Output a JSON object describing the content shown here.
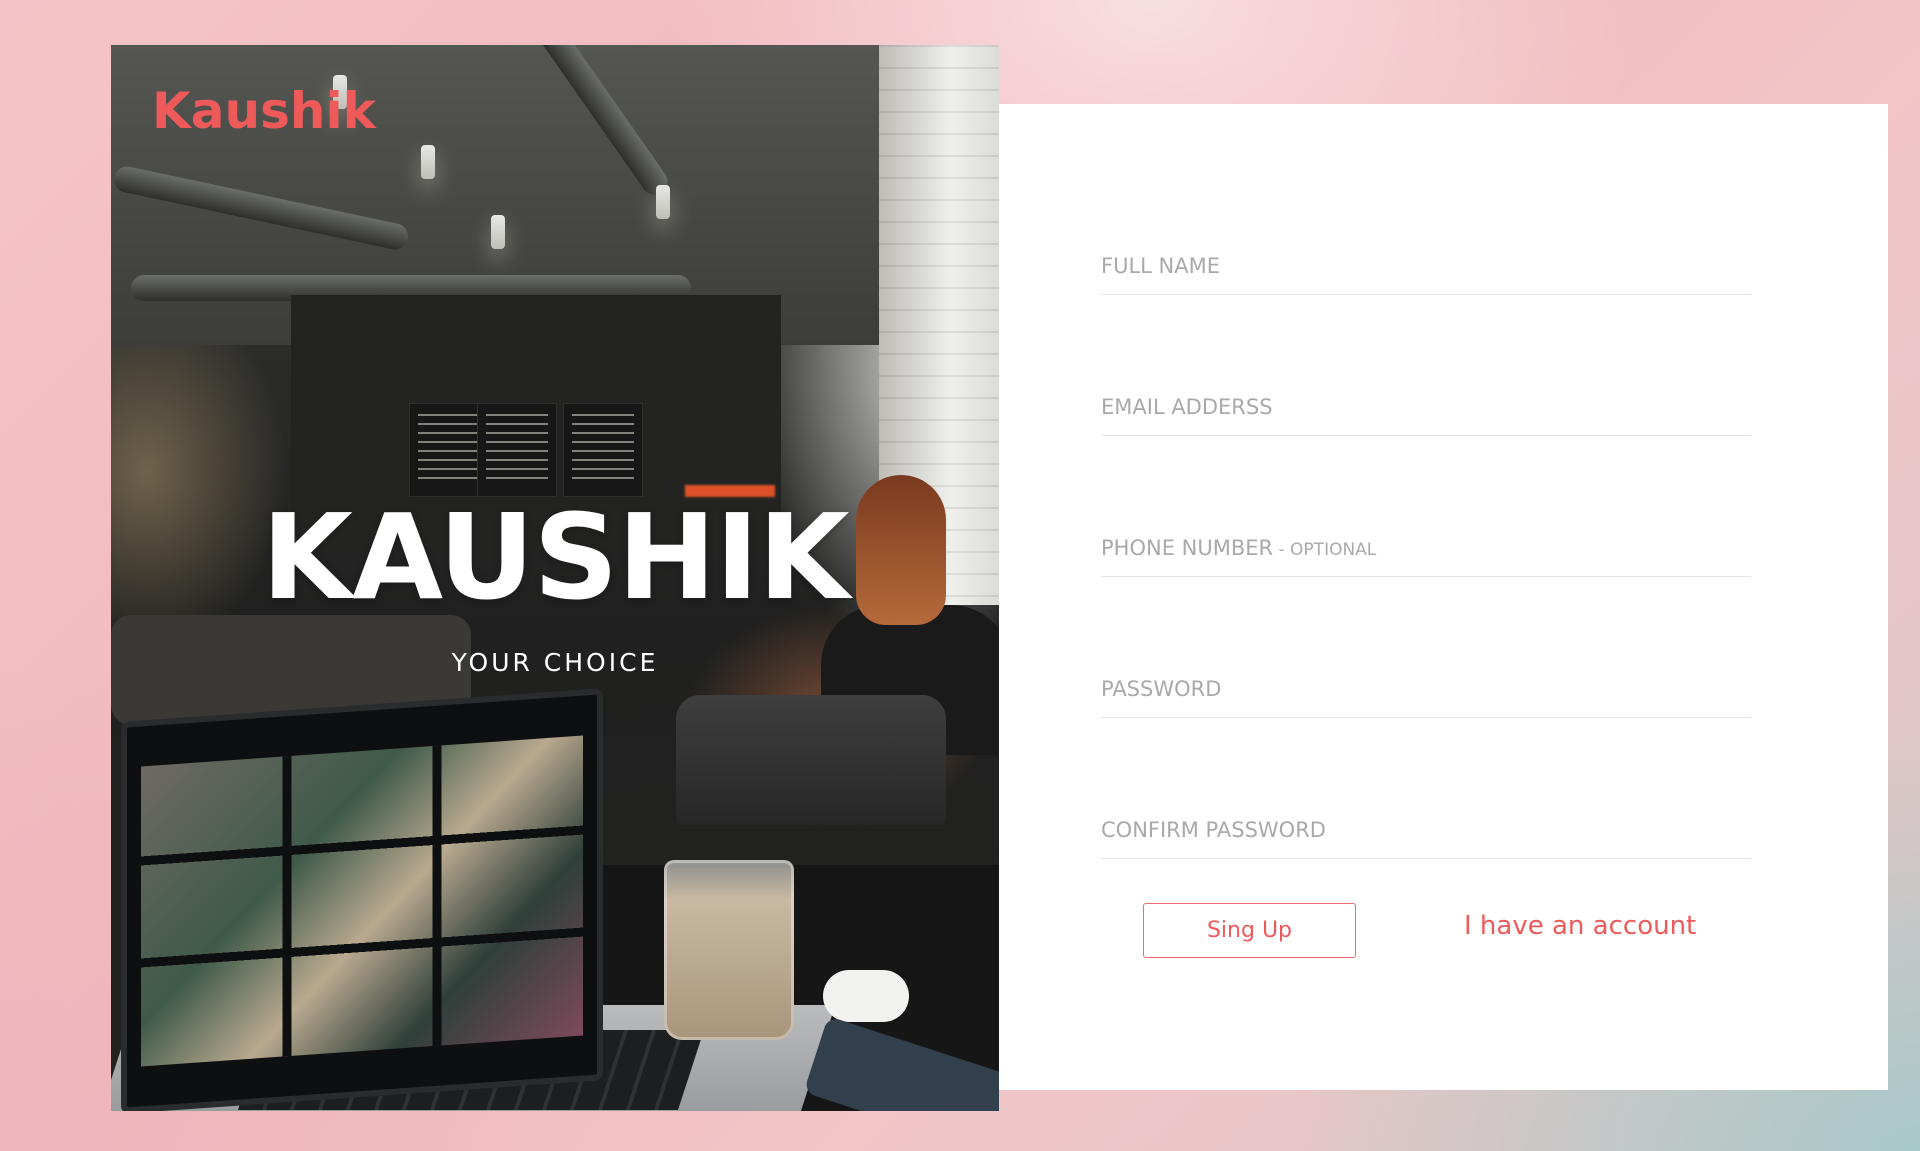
{
  "brand": {
    "logo_text": "Kaushik",
    "hero_title": "KAUSHIK",
    "hero_subtitle": "YOUR CHOICE"
  },
  "form": {
    "fields": [
      {
        "label": "FULL NAME",
        "suffix": ""
      },
      {
        "label": "EMAIL ADDERSS",
        "suffix": ""
      },
      {
        "label": "PHONE NUMBER",
        "suffix": " - OPTIONAL"
      },
      {
        "label": "PASSWORD",
        "suffix": ""
      },
      {
        "label": "CONFIRM PASSWORD",
        "suffix": ""
      }
    ],
    "signup_label": "Sing Up",
    "account_link": "I have an account"
  },
  "colors": {
    "accent": "#ee5a5a",
    "label_gray": "#a9a9a9",
    "card_bg": "#ffffff"
  }
}
